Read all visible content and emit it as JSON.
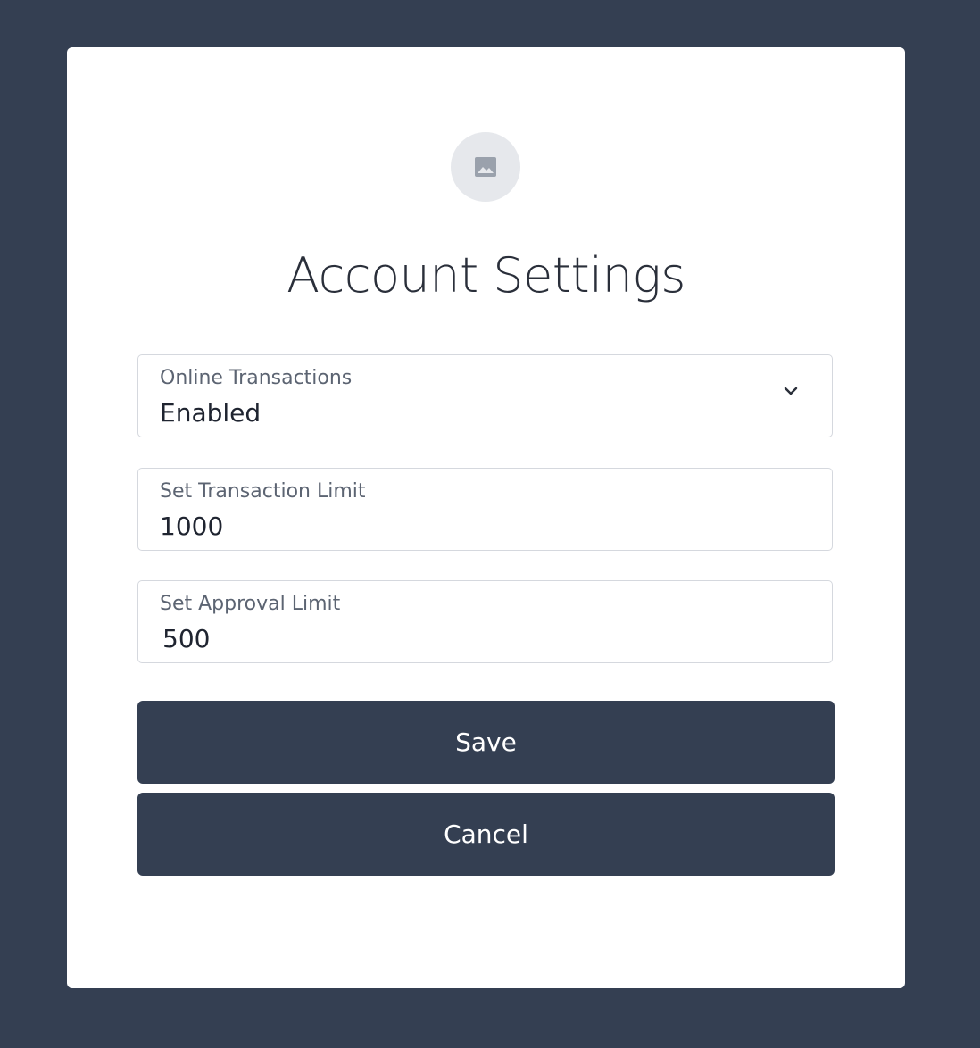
{
  "dialog": {
    "avatar_icon": "image-placeholder-icon",
    "title": "Account Settings"
  },
  "fields": {
    "online_transactions": {
      "label": "Online Transactions",
      "value": "Enabled",
      "icon": "chevron-down-icon"
    },
    "transaction_limit": {
      "label": "Set Transaction Limit",
      "value": "1000"
    },
    "approval_limit": {
      "label": "Set Approval Limit",
      "value": "500"
    }
  },
  "buttons": {
    "save_label": "Save",
    "cancel_label": "Cancel"
  },
  "colors": {
    "background": "#343f52",
    "card": "#ffffff",
    "button": "#343f52",
    "button_text": "#ffffff",
    "field_border": "#d5d8de",
    "label_text": "#5c6472",
    "avatar_bg": "#e6e8ec"
  }
}
